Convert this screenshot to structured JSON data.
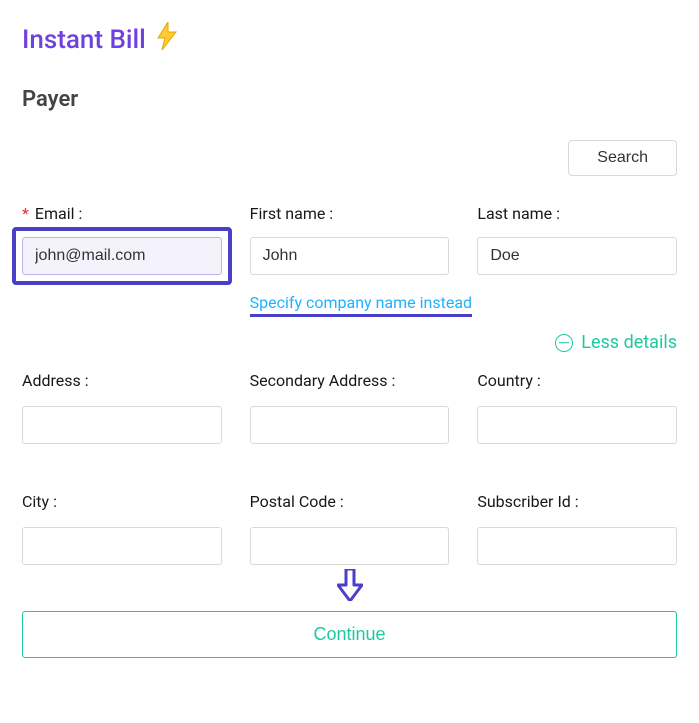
{
  "app": {
    "title": "Instant Bill"
  },
  "section": {
    "title": "Payer"
  },
  "buttons": {
    "search": "Search",
    "continue": "Continue"
  },
  "links": {
    "company": "Specify company name instead",
    "less_details": "Less details"
  },
  "fields": {
    "email": {
      "label": "Email :",
      "value": "john@mail.com",
      "required": true
    },
    "first_name": {
      "label": "First name :",
      "value": "John"
    },
    "last_name": {
      "label": "Last name :",
      "value": "Doe"
    },
    "address": {
      "label": "Address :",
      "value": ""
    },
    "secondary_address": {
      "label": "Secondary Address :",
      "value": ""
    },
    "country": {
      "label": "Country :",
      "value": ""
    },
    "city": {
      "label": "City :",
      "value": ""
    },
    "postal_code": {
      "label": "Postal Code :",
      "value": ""
    },
    "subscriber_id": {
      "label": "Subscriber Id :",
      "value": ""
    }
  }
}
